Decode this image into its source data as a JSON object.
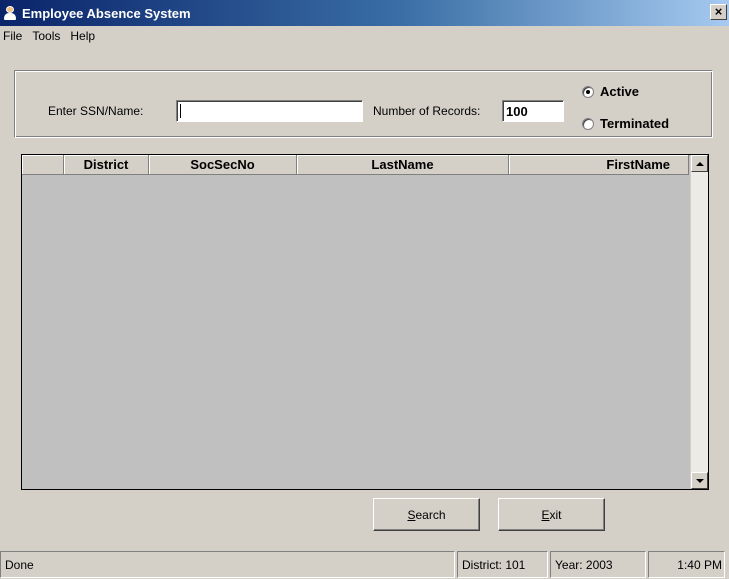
{
  "window": {
    "title": "Employee Absence System",
    "close_glyph": "×"
  },
  "menu": [
    "File",
    "Tools",
    "Help"
  ],
  "search": {
    "ssn_label": "Enter SSN/Name:",
    "ssn_value": "",
    "records_label": "Number of Records:",
    "records_value": "100",
    "status_options": [
      {
        "label": "Active",
        "checked": true
      },
      {
        "label": "Terminated",
        "checked": false
      }
    ]
  },
  "grid": {
    "columns": [
      "",
      "District",
      "SocSecNo",
      "LastName",
      "FirstName"
    ],
    "rows": [],
    "background": "#c0c0c0"
  },
  "buttons": {
    "search": {
      "accel": "S",
      "rest": "earch"
    },
    "exit": {
      "accel": "E",
      "rest": "xit"
    }
  },
  "status": {
    "message": "Done",
    "district": "District: 101",
    "year": "Year: 2003",
    "time": "1:40 PM"
  }
}
